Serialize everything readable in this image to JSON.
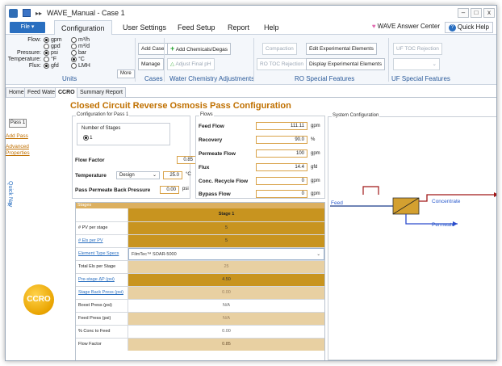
{
  "window": {
    "title": "WAVE_Manual - Case 1",
    "controls": {
      "minimize": "–",
      "maximize": "□",
      "close": "x"
    }
  },
  "menu": {
    "file": "File ▾",
    "tabs": [
      "Configuration",
      "User Settings",
      "Feed Setup",
      "Report",
      "Help"
    ],
    "answer_center": "WAVE Answer Center",
    "quick_help": "Quick Help"
  },
  "ribbon": {
    "units": {
      "flow_label": "Flow:",
      "flow_options": [
        "gpm",
        "gpd"
      ],
      "flow_options_metric": [
        "m³/h",
        "m³/d"
      ],
      "pressure_label": "Pressure:",
      "pressure_options": [
        "psi",
        "bar"
      ],
      "temperature_label": "Temperature:",
      "temperature_options": [
        "°F",
        "°C"
      ],
      "flux_label": "Flux:",
      "flux_options": [
        "gfd",
        "LMH"
      ],
      "more": "More",
      "group_label": "Units"
    },
    "cases": {
      "add_case": "Add Case",
      "manage": "Manage",
      "group_label": "Cases"
    },
    "water_chem": {
      "add_chemicals": "Add Chemicals/Degas",
      "adjust_ph": "Adjust Final pH",
      "group_label": "Water Chemistry Adjustments"
    },
    "ro_special": {
      "compaction": "Compaction",
      "edit_experimental": "Edit Experimental Elements",
      "ro_toc": "RO TOC Rejection",
      "display_experimental": "Display Experimental Elements",
      "group_label": "RO Special Features"
    },
    "uf_special": {
      "uf_toc": "UF TOC Rejection",
      "group_label": "UF Special Features"
    }
  },
  "page_tabs": [
    "Home",
    "Feed Water",
    "CCRO",
    "Summary Report"
  ],
  "left": {
    "pass_button": "Pass 1",
    "add_pass": "Add Pass",
    "advanced": "Advanced Properties",
    "quick_nav": "Quick Nav",
    "quick_nav_arrow": "»",
    "logo_text": "CCRO"
  },
  "config": {
    "heading": "Closed Circuit Reverse Osmosis Pass Configuration",
    "pass_frame_title": "Configuration for Pass 1",
    "num_stages_label": "Number of Stages",
    "num_stages_value": "1",
    "flow_factor_label": "Flow Factor",
    "flow_factor_value": "0.85",
    "temperature_label": "Temperature",
    "temperature_mode": "Design",
    "temperature_value": "25.0",
    "temperature_unit": "°C",
    "back_pressure_label": "Pass Permeate Back Pressure",
    "back_pressure_value": "0.00",
    "back_pressure_unit": "psi"
  },
  "flows": {
    "frame_title": "Flows",
    "rows": [
      {
        "label": "Feed Flow",
        "value": "111.11",
        "unit": "gpm"
      },
      {
        "label": "Recovery",
        "value": "90.0",
        "unit": "%"
      },
      {
        "label": "Permeate Flow",
        "value": "100",
        "unit": "gpm"
      },
      {
        "label": "Flux",
        "value": "14.4",
        "unit": "gfd"
      },
      {
        "label": "Conc. Recycle Flow",
        "value": "0",
        "unit": "gpm"
      },
      {
        "label": "Bypass Flow",
        "value": "0",
        "unit": "gpm"
      }
    ]
  },
  "stages": {
    "title": "Stages",
    "column": "Stage 1",
    "rows": [
      {
        "label": "# PV per stage",
        "value": "5",
        "link": false
      },
      {
        "label": "# Els per PV",
        "value": "5",
        "link": true
      },
      {
        "label": "Element Type Specs",
        "value": "FilmTec™ SOAR-5000",
        "link": true
      },
      {
        "label": "Total Els per Stage",
        "value": "25",
        "link": false
      },
      {
        "label": "Pre-stage ΔP (psi)",
        "value": "4.50",
        "link": true
      },
      {
        "label": "Stage Back Press (psi)",
        "value": "0.00",
        "link": true
      },
      {
        "label": "Boost Press (psi)",
        "value": "N/A",
        "link": false
      },
      {
        "label": "Feed Press (psi)",
        "value": "N/A",
        "link": false
      },
      {
        "label": "% Conc to Feed",
        "value": "0.00",
        "link": false
      },
      {
        "label": "Flow Factor",
        "value": "0.85",
        "link": false
      }
    ]
  },
  "system": {
    "title": "System Configuration",
    "feed": "Feed",
    "concentrate": "Concentrate",
    "permeate": "Permeate"
  },
  "colors": {
    "accent": "#c07000",
    "stage_header": "#c8941f",
    "feed_line": "#1a3a8a",
    "concentrate_line": "#a01818"
  }
}
